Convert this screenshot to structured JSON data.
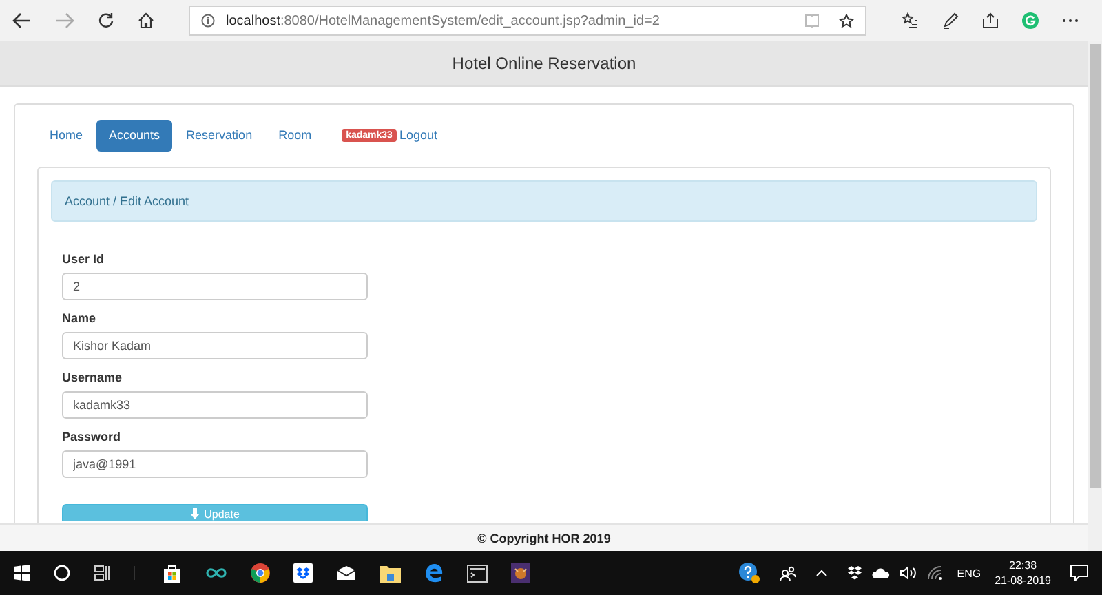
{
  "browser": {
    "url_host": "localhost",
    "url_rest": ":8080/HotelManagementSystem/edit_account.jsp?admin_id=2"
  },
  "header": {
    "title": "Hotel Online Reservation"
  },
  "nav": [
    {
      "label": "Home",
      "selected": false
    },
    {
      "label": "Accounts",
      "selected": true
    },
    {
      "label": "Reservation",
      "selected": false
    },
    {
      "label": "Room",
      "selected": false
    },
    {
      "label": "Logout",
      "selected": false,
      "badge": "kadamk33"
    }
  ],
  "breadcrumb": "Account / Edit Account",
  "fields": [
    {
      "label": "User Id",
      "value": "2"
    },
    {
      "label": "Name",
      "value": "Kishor Kadam"
    },
    {
      "label": "Username",
      "value": "kadamk33"
    },
    {
      "label": "Password",
      "value": "java@1991"
    }
  ],
  "submit": "Update",
  "footer": "© Copyright HOR 2019",
  "taskbar": {
    "language": "ENG",
    "time": "22:38",
    "date": "21-08-2019"
  }
}
